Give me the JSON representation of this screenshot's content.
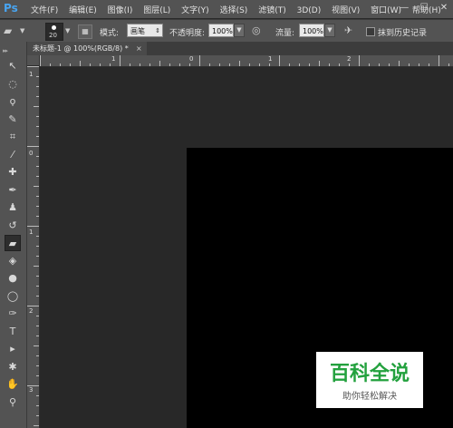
{
  "app": {
    "logo": "Ps"
  },
  "menu": [
    "文件(F)",
    "编辑(E)",
    "图像(I)",
    "图层(L)",
    "文字(Y)",
    "选择(S)",
    "滤镜(T)",
    "3D(D)",
    "视图(V)",
    "窗口(W)",
    "帮助(H)"
  ],
  "window_controls": {
    "minimize": "—",
    "restore": "☐",
    "close": "✕"
  },
  "options": {
    "brush_size": "20",
    "mode_label": "模式:",
    "mode_value": "画笔",
    "opacity_label": "不透明度:",
    "opacity_value": "100%",
    "flow_label": "流量:",
    "flow_value": "100%",
    "history_label": "抹到历史记录"
  },
  "document": {
    "tab_title": "未标题-1 @ 100%(RGB/8) *",
    "close": "×"
  },
  "ruler": {
    "h_labels": [
      "1",
      "0",
      "1",
      "2"
    ],
    "v_labels": [
      "1",
      "0",
      "1",
      "2",
      "3"
    ]
  },
  "tools": [
    {
      "name": "move",
      "glyph": "↖"
    },
    {
      "name": "marquee",
      "glyph": "◌"
    },
    {
      "name": "lasso",
      "glyph": "ϙ"
    },
    {
      "name": "quick-select",
      "glyph": "✎"
    },
    {
      "name": "crop",
      "glyph": "⌗"
    },
    {
      "name": "eyedropper",
      "glyph": "⁄"
    },
    {
      "name": "healing",
      "glyph": "✚"
    },
    {
      "name": "brush",
      "glyph": "✒"
    },
    {
      "name": "clone-stamp",
      "glyph": "♟"
    },
    {
      "name": "history-brush",
      "glyph": "↺"
    },
    {
      "name": "eraser",
      "glyph": "▰"
    },
    {
      "name": "paint-bucket",
      "glyph": "◈"
    },
    {
      "name": "blur",
      "glyph": "●"
    },
    {
      "name": "dodge",
      "glyph": "◯"
    },
    {
      "name": "pen",
      "glyph": "✑"
    },
    {
      "name": "type",
      "glyph": "T"
    },
    {
      "name": "path-select",
      "glyph": "▸"
    },
    {
      "name": "shape",
      "glyph": "✱"
    },
    {
      "name": "hand",
      "glyph": "✋"
    },
    {
      "name": "zoom",
      "glyph": "⚲"
    }
  ],
  "watermark": {
    "title": "百科全说",
    "subtitle": "助你轻松解决"
  },
  "colors": {
    "bg": "#282828",
    "panel": "#535353",
    "canvas": "#000000",
    "ps_blue": "#48a4f0",
    "watermark_green": "#23a13e"
  }
}
